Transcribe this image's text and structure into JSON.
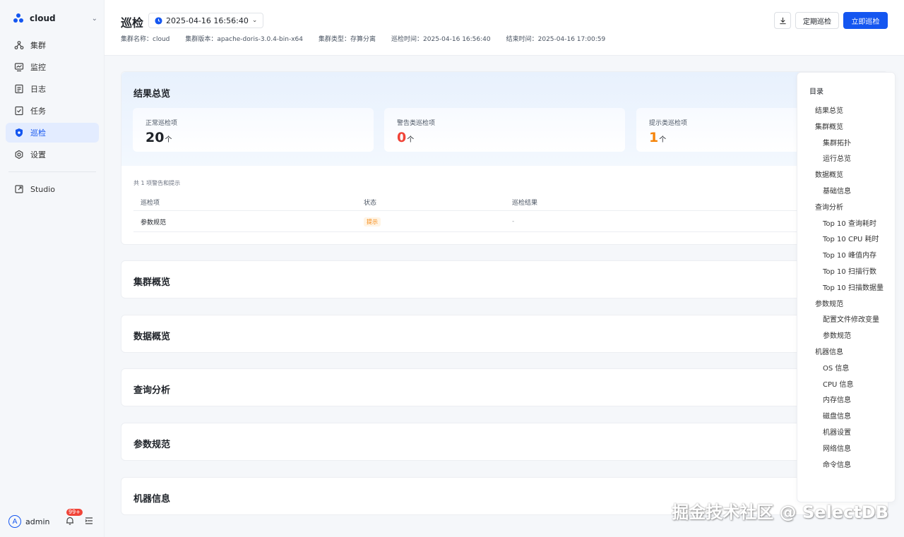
{
  "app": {
    "cluster_name": "cloud"
  },
  "sidebar": {
    "items": [
      {
        "label": "集群",
        "icon": "cluster-icon"
      },
      {
        "label": "监控",
        "icon": "monitor-icon"
      },
      {
        "label": "日志",
        "icon": "log-icon"
      },
      {
        "label": "任务",
        "icon": "task-icon"
      },
      {
        "label": "巡检",
        "icon": "inspection-icon",
        "active": true
      },
      {
        "label": "设置",
        "icon": "settings-icon"
      }
    ],
    "studio_label": "Studio",
    "user": {
      "avatar_letter": "A",
      "name": "admin",
      "notifications": "99+"
    }
  },
  "header": {
    "title": "巡检",
    "time": "2025-04-16 16:56:40",
    "meta": {
      "cluster_name": "集群名称：cloud",
      "cluster_version": "集群版本：apache-doris-3.0.4-bin-x64",
      "cluster_type": "集群类型：存算分离",
      "inspect_time": "巡检时间：2025-04-16 16:56:40",
      "end_time": "结束时间：2025-04-16 17:00:59"
    },
    "buttons": {
      "scheduled": "定期巡检",
      "run_now": "立即巡检"
    }
  },
  "summary": {
    "title": "结果总览",
    "stats": [
      {
        "label": "正常巡检项",
        "value": "20",
        "unit": "个",
        "color": "#1f2329"
      },
      {
        "label": "警告类巡检项",
        "value": "0",
        "unit": "个",
        "color": "#f04438"
      },
      {
        "label": "提示类巡检项",
        "value": "1",
        "unit": "个",
        "color": "#f5840a"
      }
    ],
    "count_text": "共 1 项警告和提示",
    "table": {
      "headers": [
        "巡检项",
        "状态",
        "巡检结果"
      ],
      "rows": [
        {
          "item": "参数规范",
          "status": "提示",
          "result": "-"
        }
      ]
    }
  },
  "sections": [
    "集群概览",
    "数据概览",
    "查询分析",
    "参数规范",
    "机器信息"
  ],
  "toc": {
    "title": "目录",
    "items": [
      {
        "label": "结果总览",
        "level": 1
      },
      {
        "label": "集群概览",
        "level": 1
      },
      {
        "label": "集群拓扑",
        "level": 2
      },
      {
        "label": "运行总览",
        "level": 2
      },
      {
        "label": "数据概览",
        "level": 1
      },
      {
        "label": "基础信息",
        "level": 2
      },
      {
        "label": "查询分析",
        "level": 1
      },
      {
        "label": "Top 10 查询耗时",
        "level": 2
      },
      {
        "label": "Top 10 CPU 耗时",
        "level": 2
      },
      {
        "label": "Top 10 峰值内存",
        "level": 2
      },
      {
        "label": "Top 10 扫描行数",
        "level": 2
      },
      {
        "label": "Top 10 扫描数据量",
        "level": 2
      },
      {
        "label": "参数规范",
        "level": 1
      },
      {
        "label": "配置文件修改变量",
        "level": 2
      },
      {
        "label": "参数规范",
        "level": 2
      },
      {
        "label": "机器信息",
        "level": 1
      },
      {
        "label": "OS 信息",
        "level": 2
      },
      {
        "label": "CPU 信息",
        "level": 2
      },
      {
        "label": "内存信息",
        "level": 2
      },
      {
        "label": "磁盘信息",
        "level": 2
      },
      {
        "label": "机器设置",
        "level": 2
      },
      {
        "label": "网络信息",
        "level": 2
      },
      {
        "label": "命令信息",
        "level": 2
      }
    ]
  },
  "watermark": "掘金技术社区 @ SelectDB",
  "colors": {
    "accent": "#1456f0",
    "warning": "#f04438",
    "hint": "#f5840a"
  }
}
